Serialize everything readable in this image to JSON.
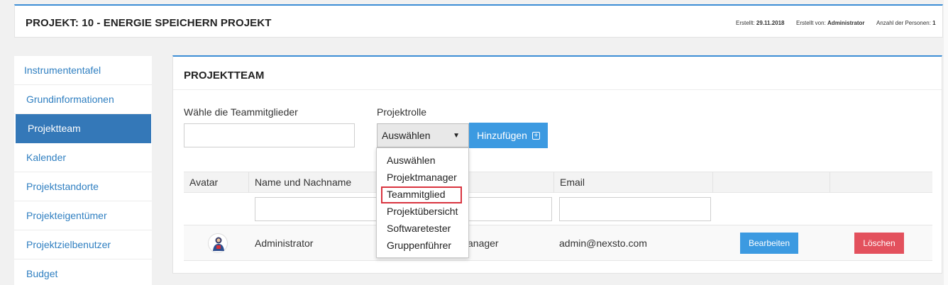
{
  "header": {
    "title": "PROJEKT: 10 - ENERGIE SPEICHERN PROJEKT",
    "created_label": "Erstellt:",
    "created_value": "29.11.2018",
    "created_by_label": "Erstellt von:",
    "created_by_value": "Administrator",
    "persons_label": "Anzahl der Personen:",
    "persons_value": "1"
  },
  "sidebar": {
    "items": [
      {
        "label": "Instrumententafel"
      },
      {
        "label": "Grundinformationen"
      },
      {
        "label": "Projektteam"
      },
      {
        "label": "Kalender"
      },
      {
        "label": "Projektstandorte"
      },
      {
        "label": "Projekteigentümer"
      },
      {
        "label": "Projektzielbenutzer"
      },
      {
        "label": "Budget"
      }
    ],
    "active_index": 2
  },
  "panel": {
    "title": "PROJEKTTEAM",
    "members_label": "Wähle die Teammitglieder",
    "members_value": "",
    "role_label": "Projektrolle",
    "role_selected": "Auswählen",
    "add_button": "Hinzufügen",
    "add_icon": "plus-square-icon"
  },
  "role_dropdown": {
    "options": [
      "Auswählen",
      "Projektmanager",
      "Teammitglied",
      "Projektübersicht",
      "Softwaretester",
      "Gruppenführer"
    ],
    "highlighted": "Teammitglied"
  },
  "table": {
    "columns": [
      "Avatar",
      "Name und Nachname",
      "",
      "Email",
      "",
      ""
    ],
    "rows": [
      {
        "avatar": "user-avatar-icon",
        "name": "Administrator",
        "role": "anager",
        "email": "admin@nexsto.com",
        "edit_label": "Bearbeiten",
        "delete_label": "Löschen"
      }
    ]
  },
  "colors": {
    "accent": "#3c8dd5",
    "active_nav": "#3478b8",
    "primary_button": "#3c9ae1",
    "danger_button": "#e3515d",
    "highlight_border": "#d9343f"
  }
}
